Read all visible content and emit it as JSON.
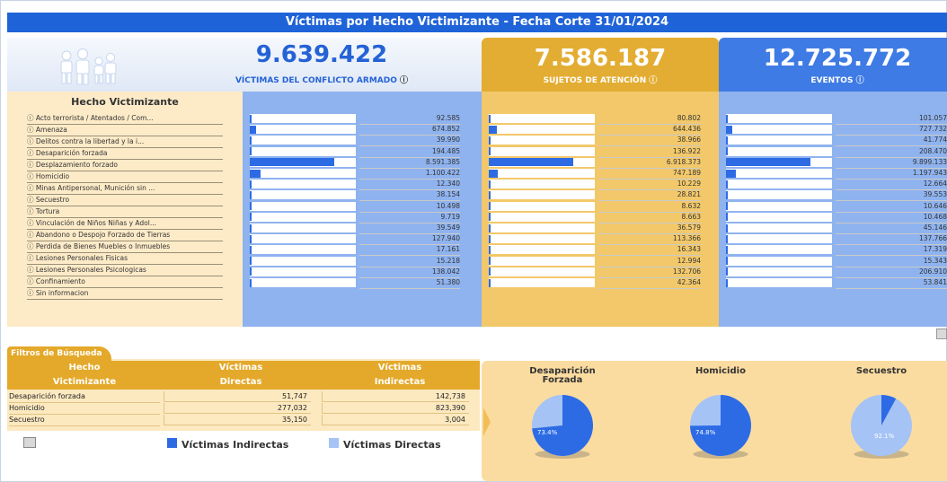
{
  "title": "Víctimas por Hecho Victimizante - Fecha Corte 31/01/2024",
  "summary": {
    "victimas": {
      "value": "9.639.422",
      "label": "VÍCTIMAS DEL CONFLICTO ARMADO"
    },
    "sujetos": {
      "value": "7.586.187",
      "label": "SUJETOS DE ATENCIÓN"
    },
    "eventos": {
      "value": "12.725.772",
      "label": "EVENTOS"
    },
    "info_glyph": "ⓘ"
  },
  "table": {
    "header": "Hecho Victimizante",
    "rows": [
      {
        "label": "Acto terrorista / Atentados / Com...",
        "v1": "92.585",
        "v2": "80.802",
        "v3": "101.057",
        "f1": 0.011,
        "f2": 0.012,
        "f3": 0.01
      },
      {
        "label": "Amenaza",
        "v1": "674.852",
        "v2": "644.436",
        "v3": "727.732",
        "f1": 0.079,
        "f2": 0.093,
        "f3": 0.074
      },
      {
        "label": "Delitos contra la libertad y la i...",
        "v1": "39.990",
        "v2": "38.966",
        "v3": "41.774",
        "f1": 0.005,
        "f2": 0.006,
        "f3": 0.004
      },
      {
        "label": "Desaparición forzada",
        "v1": "194.485",
        "v2": "136.922",
        "v3": "208.470",
        "f1": 0.023,
        "f2": 0.02,
        "f3": 0.021
      },
      {
        "label": "Desplazamiento forzado",
        "v1": "8.591.385",
        "v2": "6.918.373",
        "v3": "9.899.133",
        "f1": 1.0,
        "f2": 1.0,
        "f3": 1.0
      },
      {
        "label": "Homicidio",
        "v1": "1.100.422",
        "v2": "747.189",
        "v3": "1.197.943",
        "f1": 0.128,
        "f2": 0.108,
        "f3": 0.121
      },
      {
        "label": "Minas Antipersonal, Munición sin ...",
        "v1": "12.340",
        "v2": "10.229",
        "v3": "12.664",
        "f1": 0.0014,
        "f2": 0.0015,
        "f3": 0.0013
      },
      {
        "label": "Secuestro",
        "v1": "38.154",
        "v2": "28.821",
        "v3": "39.553",
        "f1": 0.004,
        "f2": 0.004,
        "f3": 0.004
      },
      {
        "label": "Tortura",
        "v1": "10.498",
        "v2": "8.632",
        "v3": "10.646",
        "f1": 0.0012,
        "f2": 0.0012,
        "f3": 0.0011
      },
      {
        "label": "Vinculación de Niños Niñas y Adol...",
        "v1": "9.719",
        "v2": "8.663",
        "v3": "10.468",
        "f1": 0.0011,
        "f2": 0.0013,
        "f3": 0.0011
      },
      {
        "label": "Abandono o Despojo Forzado de Tierras",
        "v1": "39.549",
        "v2": "36.579",
        "v3": "45.146",
        "f1": 0.005,
        "f2": 0.005,
        "f3": 0.005
      },
      {
        "label": "Perdida de Bienes Muebles o Inmuebles",
        "v1": "127.940",
        "v2": "113.366",
        "v3": "137.766",
        "f1": 0.015,
        "f2": 0.016,
        "f3": 0.014
      },
      {
        "label": "Lesiones Personales Fisicas",
        "v1": "17.161",
        "v2": "16.343",
        "v3": "17.319",
        "f1": 0.002,
        "f2": 0.0024,
        "f3": 0.0017
      },
      {
        "label": "Lesiones Personales Psicologicas",
        "v1": "15.218",
        "v2": "12.994",
        "v3": "15.343",
        "f1": 0.0018,
        "f2": 0.0019,
        "f3": 0.0016
      },
      {
        "label": "Confinamiento",
        "v1": "138.042",
        "v2": "132.706",
        "v3": "206.910",
        "f1": 0.016,
        "f2": 0.019,
        "f3": 0.021
      },
      {
        "label": "Sin informacion",
        "v1": "51.380",
        "v2": "42.364",
        "v3": "53.841",
        "f1": 0.006,
        "f2": 0.006,
        "f3": 0.005
      }
    ]
  },
  "filters": {
    "tab": "Filtros de Búsqueda",
    "headers": [
      [
        "Hecho",
        "Victimizante"
      ],
      [
        "Víctimas",
        "Directas"
      ],
      [
        "Víctimas",
        "Indirectas"
      ]
    ],
    "rows": [
      {
        "name": "Desaparición forzada",
        "directas": "51,747",
        "indirectas": "142,738"
      },
      {
        "name": "Homicidio",
        "directas": "277,032",
        "indirectas": "823,390"
      },
      {
        "name": "Secuestro",
        "directas": "35,150",
        "indirectas": "3,004"
      }
    ]
  },
  "legend": {
    "indirectas": "Víctimas Indirectas",
    "directas": "Víctimas Directas"
  },
  "colors": {
    "indirectas": "#2d6be5",
    "directas": "#a5c3f5"
  },
  "pies": [
    {
      "title_lines": [
        "Desaparición",
        "Forzada"
      ],
      "indirect_share": 0.734,
      "label": "73.4%"
    },
    {
      "title_lines": [
        "Homicidio"
      ],
      "indirect_share": 0.748,
      "label": "74.8%"
    },
    {
      "title_lines": [
        "Secuestro"
      ],
      "indirect_share": 0.079,
      "direct_share": 0.921,
      "label": "92.1%"
    }
  ]
}
